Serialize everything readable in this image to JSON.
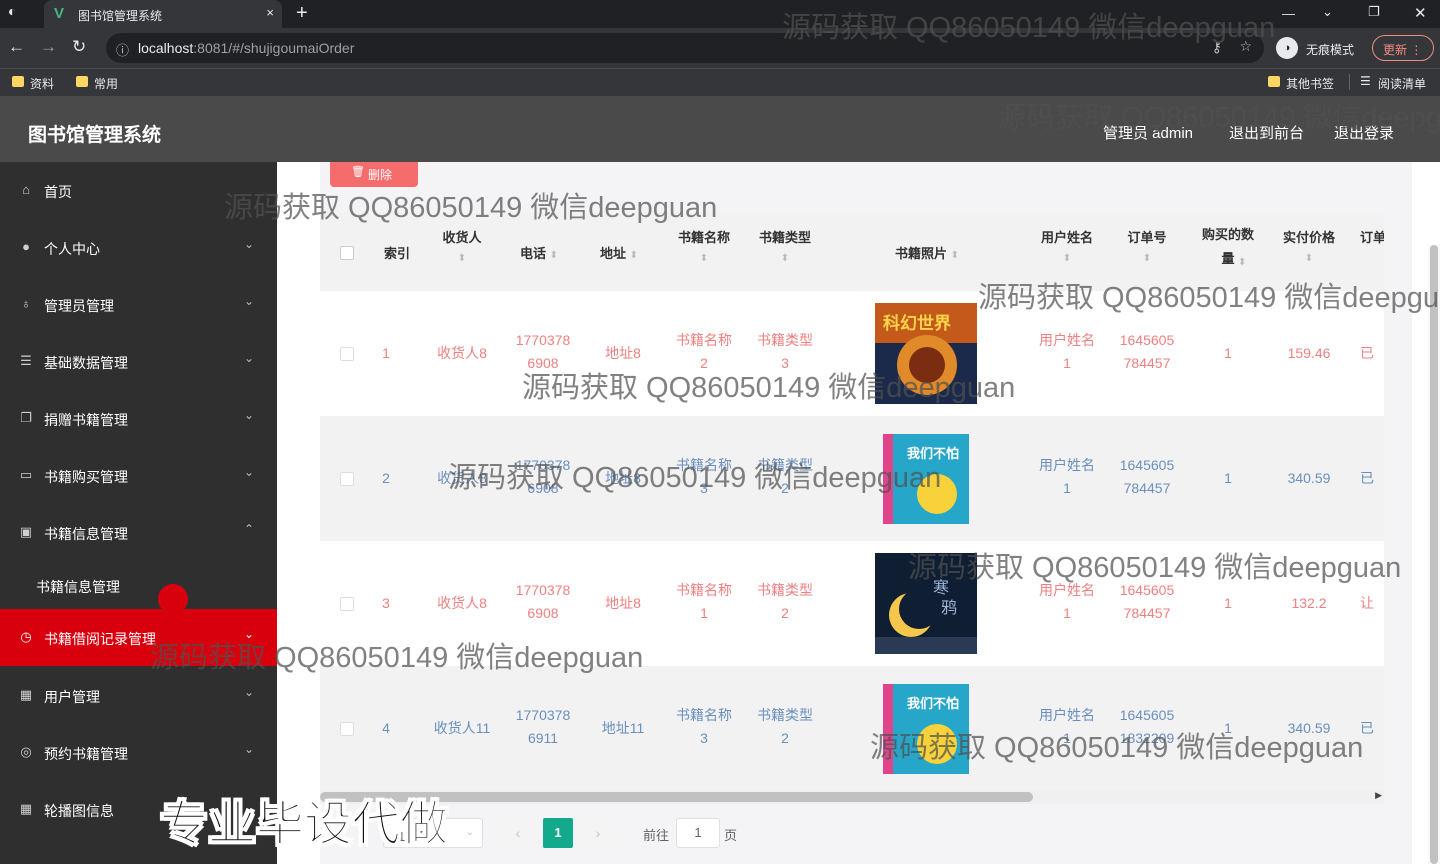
{
  "browser": {
    "tab_title": "图书馆管理系统",
    "tab_close": "×",
    "new_tab": "+",
    "url_host": "localhost",
    "url_rest": ":8081/#/shujigoumaiOrder",
    "incognito_label": "无痕模式",
    "update_label": "更新",
    "bookmarks": [
      "资料",
      "常用"
    ],
    "other_bookmarks": "其他书签",
    "reading_list": "阅读清单"
  },
  "app": {
    "title": "图书馆管理系统",
    "header_links": [
      "管理员 admin",
      "退出到前台",
      "退出登录"
    ]
  },
  "sidebar": {
    "items": [
      {
        "label": "首页",
        "icon": "home-icon"
      },
      {
        "label": "个人中心",
        "icon": "user-icon"
      },
      {
        "label": "管理员管理",
        "icon": "mic-icon"
      },
      {
        "label": "基础数据管理",
        "icon": "sliders-icon"
      },
      {
        "label": "捐赠书籍管理",
        "icon": "copy-icon"
      },
      {
        "label": "书籍购买管理",
        "icon": "cart-icon"
      },
      {
        "label": "书籍信息管理",
        "icon": "box-icon"
      },
      {
        "label": "书籍借阅记录管理",
        "icon": "clock-icon"
      },
      {
        "label": "用户管理",
        "icon": "grid-icon"
      },
      {
        "label": "预约书籍管理",
        "icon": "compass-icon"
      },
      {
        "label": "轮播图信息",
        "icon": "grid-icon"
      }
    ],
    "submenu": [
      "书籍信息管理"
    ]
  },
  "toolbar": {
    "delete_label": "删除"
  },
  "table": {
    "headers": [
      "索引",
      "收货人",
      "电话",
      "地址",
      "书籍名称",
      "书籍类型",
      "书籍照片",
      "用户姓名",
      "订单号",
      "购买的数量",
      "实付价格",
      "订单"
    ],
    "rows": [
      {
        "index": "1",
        "receiver": "收货人8",
        "phone": [
          "1770378",
          "6908"
        ],
        "address": "地址8",
        "book_name": [
          "书籍名称",
          "2"
        ],
        "book_type": [
          "书籍类型",
          "3"
        ],
        "user": [
          "用户姓名",
          "1"
        ],
        "order_no": [
          "1645605",
          "784457"
        ],
        "qty": "1",
        "price": "159.46",
        "status": "已",
        "color": "red"
      },
      {
        "index": "2",
        "receiver": "收货人8",
        "phone": [
          "1770378",
          "6908"
        ],
        "address": "地址8",
        "book_name": [
          "书籍名称",
          "3"
        ],
        "book_type": [
          "书籍类型",
          "2"
        ],
        "user": [
          "用户姓名",
          "1"
        ],
        "order_no": [
          "1645605",
          "784457"
        ],
        "qty": "1",
        "price": "340.59",
        "status": "已",
        "color": "blue"
      },
      {
        "index": "3",
        "receiver": "收货人8",
        "phone": [
          "1770378",
          "6908"
        ],
        "address": "地址8",
        "book_name": [
          "书籍名称",
          "1"
        ],
        "book_type": [
          "书籍类型",
          "2"
        ],
        "user": [
          "用户姓名",
          "1"
        ],
        "order_no": [
          "1645605",
          "784457"
        ],
        "qty": "1",
        "price": "132.2",
        "status": "让",
        "color": "red"
      },
      {
        "index": "4",
        "receiver": "收货人11",
        "phone": [
          "1770378",
          "6911"
        ],
        "address": "地址11",
        "book_name": [
          "书籍名称",
          "3"
        ],
        "book_type": [
          "书籍类型",
          "2"
        ],
        "user": [
          "用户姓名",
          "1"
        ],
        "order_no": [
          "1645605",
          "1832209"
        ],
        "qty": "1",
        "price": "340.59",
        "status": "已",
        "color": "blue"
      }
    ]
  },
  "pagination": {
    "page_size": "10条/页",
    "current_page": "1",
    "goto_label": "前往",
    "goto_value": "1",
    "page_suffix": "页"
  },
  "overlays": {
    "watermark": "源码获取 QQ86050149 微信deepguan",
    "promo": "专业毕设代做"
  },
  "colors": {
    "sidebar_active": "#d9000e",
    "delete_button": "#f56c6c",
    "page_active": "#13a98d"
  }
}
